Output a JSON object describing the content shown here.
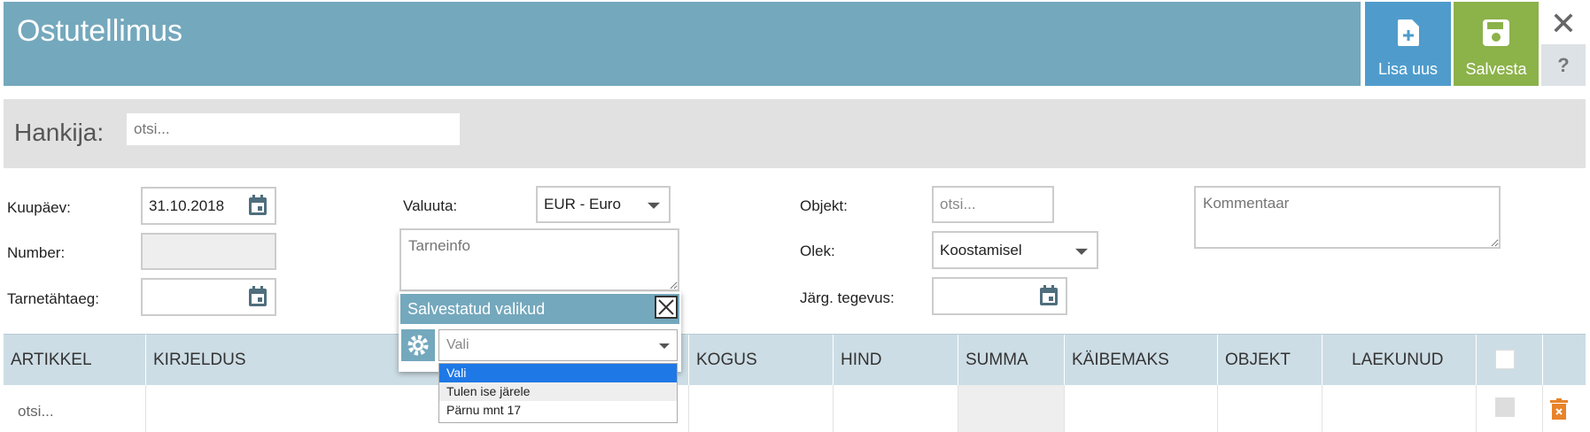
{
  "header": {
    "title": "Ostutellimus",
    "new_label": "Lisa uus",
    "save_label": "Salvesta",
    "close": "✕",
    "help": "?"
  },
  "supplier": {
    "label": "Hankija:",
    "placeholder": "otsi..."
  },
  "form": {
    "date_label": "Kuupäev:",
    "date_value": "31.10.2018",
    "number_label": "Number:",
    "number_value": "",
    "deadline_label": "Tarnetähtaeg:",
    "deadline_value": "",
    "currency_label": "Valuuta:",
    "currency_value": "EUR - Euro",
    "delivery_placeholder": "Tarneinfo",
    "object_label": "Objekt:",
    "object_placeholder": "otsi...",
    "status_label": "Olek:",
    "status_value": "Koostamisel",
    "next_action_label": "Järg. tegevus:",
    "next_action_value": "",
    "comment_placeholder": "Kommentaar"
  },
  "table": {
    "columns": [
      "ARTIKKEL",
      "KIRJELDUS",
      "KOGUS",
      "HIND",
      "SUMMA",
      "KÄIBEMAKS",
      "OBJEKT",
      "LAEKUNUD"
    ],
    "row": {
      "article_placeholder": "otsi..."
    }
  },
  "popup": {
    "title": "Salvestatud valikud",
    "select_value": "Vali",
    "options": [
      "Vali",
      "Tulen ise järele",
      "Pärnu mnt 17"
    ]
  },
  "colors": {
    "header": "#74a8bd",
    "new_button": "#4f9ccc",
    "save_button": "#8cb24a",
    "delete_icon": "#e8832a"
  },
  "icons": {
    "new": "file-plus-icon",
    "save": "floppy-icon",
    "calendar": "calendar-icon",
    "gear": "gear-icon",
    "delete": "trash-icon"
  }
}
